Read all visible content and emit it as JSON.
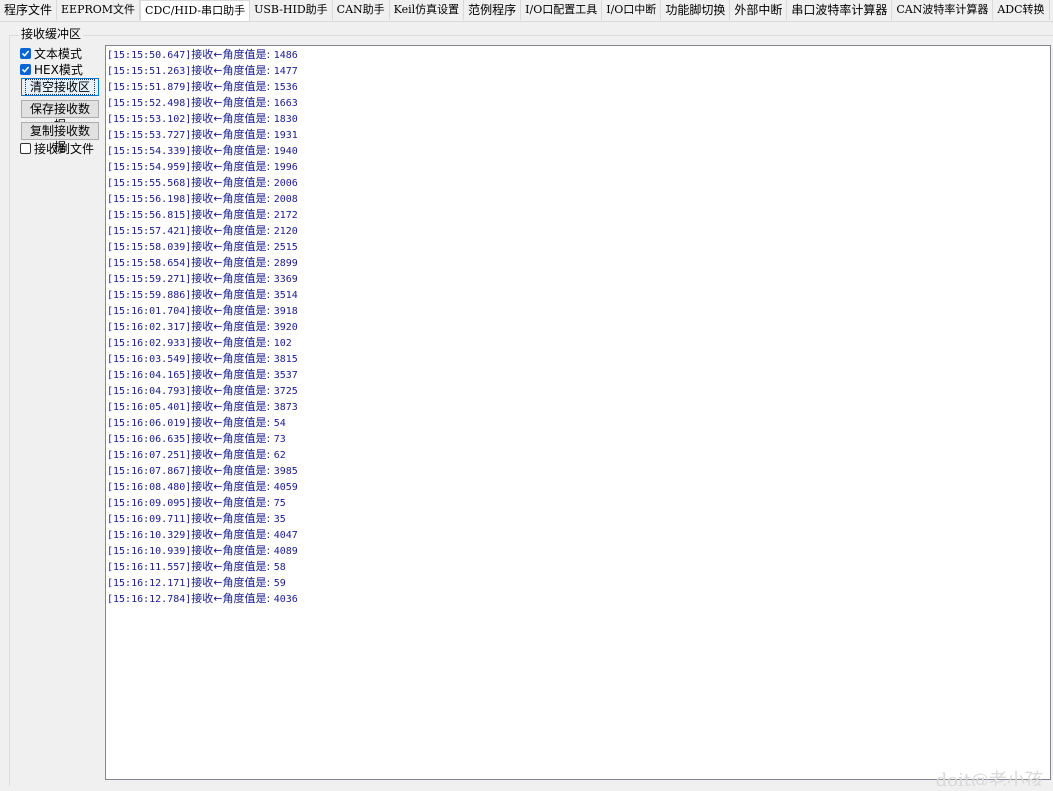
{
  "tabs": [
    {
      "label": "程序文件"
    },
    {
      "label": "EEPROM文件"
    },
    {
      "label": "CDC/HID-串口助手",
      "active": true
    },
    {
      "label": "USB-HID助手"
    },
    {
      "label": "CAN助手"
    },
    {
      "label": "Keil仿真设置"
    },
    {
      "label": "范例程序"
    },
    {
      "label": "I/O口配置工具"
    },
    {
      "label": "I/O口中断"
    },
    {
      "label": "功能脚切换"
    },
    {
      "label": "外部中断"
    },
    {
      "label": "串口波特率计算器"
    },
    {
      "label": "CAN波特率计算器"
    },
    {
      "label": "ADC转换"
    }
  ],
  "receive": {
    "group_title": "接收缓冲区",
    "text_mode_label": "文本模式",
    "text_mode_checked": true,
    "hex_mode_label": "HEX模式",
    "hex_mode_checked": true,
    "clear_button": "清空接收区",
    "save_button": "保存接收数据",
    "copy_button": "复制接收数据",
    "to_file_label": "接收到文件",
    "to_file_checked": false,
    "prefix": "接收←角度值是: ",
    "lines": [
      {
        "ts": "15:15:50.647",
        "value": "1486"
      },
      {
        "ts": "15:15:51.263",
        "value": "1477"
      },
      {
        "ts": "15:15:51.879",
        "value": "1536"
      },
      {
        "ts": "15:15:52.498",
        "value": "1663"
      },
      {
        "ts": "15:15:53.102",
        "value": "1830"
      },
      {
        "ts": "15:15:53.727",
        "value": "1931"
      },
      {
        "ts": "15:15:54.339",
        "value": "1940"
      },
      {
        "ts": "15:15:54.959",
        "value": "1996"
      },
      {
        "ts": "15:15:55.568",
        "value": "2006"
      },
      {
        "ts": "15:15:56.198",
        "value": "2008"
      },
      {
        "ts": "15:15:56.815",
        "value": "2172"
      },
      {
        "ts": "15:15:57.421",
        "value": "2120"
      },
      {
        "ts": "15:15:58.039",
        "value": "2515"
      },
      {
        "ts": "15:15:58.654",
        "value": "2899"
      },
      {
        "ts": "15:15:59.271",
        "value": "3369"
      },
      {
        "ts": "15:15:59.886",
        "value": "3514"
      },
      {
        "ts": "15:16:01.704",
        "value": "3918"
      },
      {
        "ts": "15:16:02.317",
        "value": "3920"
      },
      {
        "ts": "15:16:02.933",
        "value": "102"
      },
      {
        "ts": "15:16:03.549",
        "value": "3815"
      },
      {
        "ts": "15:16:04.165",
        "value": "3537"
      },
      {
        "ts": "15:16:04.793",
        "value": "3725"
      },
      {
        "ts": "15:16:05.401",
        "value": "3873"
      },
      {
        "ts": "15:16:06.019",
        "value": "54"
      },
      {
        "ts": "15:16:06.635",
        "value": "73"
      },
      {
        "ts": "15:16:07.251",
        "value": "62"
      },
      {
        "ts": "15:16:07.867",
        "value": "3985"
      },
      {
        "ts": "15:16:08.480",
        "value": "4059"
      },
      {
        "ts": "15:16:09.095",
        "value": "75"
      },
      {
        "ts": "15:16:09.711",
        "value": "35"
      },
      {
        "ts": "15:16:10.329",
        "value": "4047"
      },
      {
        "ts": "15:16:10.939",
        "value": "4089"
      },
      {
        "ts": "15:16:11.557",
        "value": "58"
      },
      {
        "ts": "15:16:12.171",
        "value": "59"
      },
      {
        "ts": "15:16:12.784",
        "value": "4036"
      }
    ]
  },
  "watermark": "doit@老小孩",
  "colors": {
    "checkbox_accent": "#0a64d6",
    "log_text": "#1a1a8c"
  }
}
